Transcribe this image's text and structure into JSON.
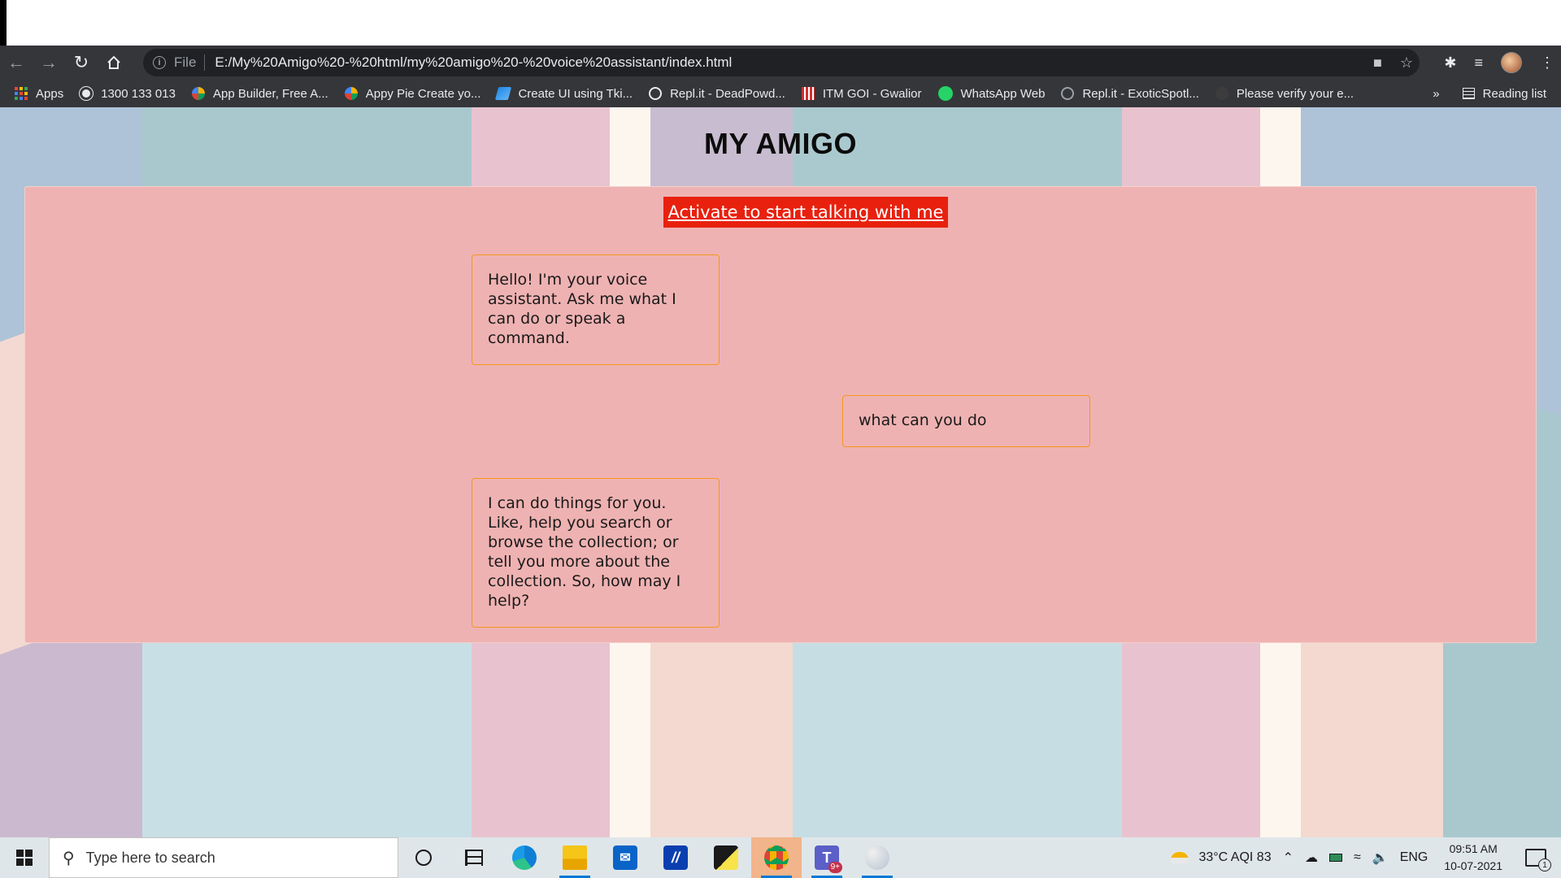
{
  "browser": {
    "file_label": "File",
    "url": "E:/My%20Amigo%20-%20html/my%20amigo%20-%20voice%20assistant/index.html"
  },
  "bookmarks": {
    "items": [
      {
        "label": "Apps",
        "icon": "apps-grid-icon",
        "color": "#4285f4"
      },
      {
        "label": "1300 133 013",
        "icon": "globe-icon",
        "color": "#e8eaed"
      },
      {
        "label": "App Builder, Free A...",
        "icon": "appypie-icon",
        "color": "#f4b400"
      },
      {
        "label": "Appy Pie Create yo...",
        "icon": "appypie-icon",
        "color": "#0f9d58"
      },
      {
        "label": "Create UI using Tki...",
        "icon": "tkinter-icon",
        "color": "#2196f3"
      },
      {
        "label": "Repl.it - DeadPowd...",
        "icon": "replit-icon",
        "color": "#e8eaed"
      },
      {
        "label": "ITM GOI - Gwalior",
        "icon": "itm-icon",
        "color": "#d32f2f"
      },
      {
        "label": "WhatsApp Web",
        "icon": "whatsapp-icon",
        "color": "#25d366"
      },
      {
        "label": "Repl.it - ExoticSpotl...",
        "icon": "replit-icon",
        "color": "#9aa0a6"
      },
      {
        "label": "Please verify your e...",
        "icon": "github-icon",
        "color": "#3c3c3c"
      }
    ],
    "more": "»",
    "reading_list": "Reading list"
  },
  "page": {
    "title": "MY AMIGO",
    "activate_button": "Activate to start talking with me",
    "messages": [
      {
        "from": "assistant",
        "text": "Hello! I'm your voice assistant. Ask me what I can do or speak a command."
      },
      {
        "from": "user",
        "text": "what can you do"
      },
      {
        "from": "assistant",
        "text": "I can do things for you. Like, help you search or browse the collection; or tell you more about the collection. So, how may I help?"
      }
    ]
  },
  "taskbar": {
    "search_placeholder": "Type here to search",
    "weather": "33°C  AQI 83",
    "language": "ENG",
    "time": "09:51 AM",
    "date": "10-07-2021",
    "notification_count": "1",
    "teams_badge": "9+"
  },
  "colors": {
    "panel": "#efb2b2",
    "activate_button": "#e8210e",
    "message_border": "#f3981c",
    "chrome_dark": "#35363a"
  }
}
